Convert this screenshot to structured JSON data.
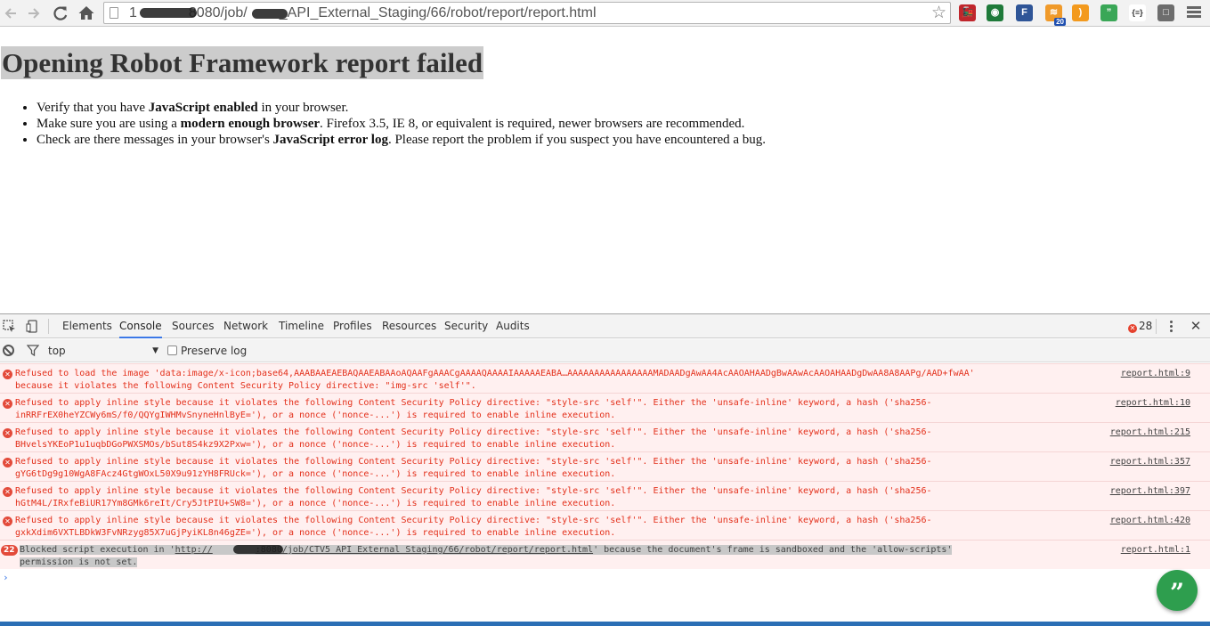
{
  "browser": {
    "url_parts": [
      "1",
      "8080/job/",
      "_API_External_Staging/66/robot/report/report.html"
    ],
    "extensions": [
      {
        "name": "train-ext-icon",
        "color": "#c0262c",
        "glyph": "🚂",
        "badge": ""
      },
      {
        "name": "evernote-ext-icon",
        "color": "#1f7a3a",
        "glyph": "◉",
        "badge": ""
      },
      {
        "name": "feedly-ext-icon",
        "color": "#2f5597",
        "glyph": "F",
        "badge": ""
      },
      {
        "name": "rss-badge-ext-icon",
        "color": "#f09a2a",
        "glyph": "≋",
        "badge": "20"
      },
      {
        "name": "rss-ext-icon",
        "color": "#f39a1e",
        "glyph": ")",
        "badge": ""
      },
      {
        "name": "hangouts-ext-icon",
        "color": "#3aa757",
        "glyph": "”",
        "badge": ""
      },
      {
        "name": "json-ext-icon",
        "color": "#ffffff",
        "glyph": "{≡}",
        "badge": ""
      },
      {
        "name": "window-ext-icon",
        "color": "#6d6d6d",
        "glyph": "□",
        "badge": ""
      }
    ]
  },
  "page": {
    "title": "Opening Robot Framework report failed",
    "items": [
      {
        "pre": "Verify that you have ",
        "bold": "JavaScript enabled",
        "post": " in your browser."
      },
      {
        "pre": "Make sure you are using a ",
        "bold": "modern enough browser",
        "post": ". Firefox 3.5, IE 8, or equivalent is required, newer browsers are recommended."
      },
      {
        "pre": "Check are there messages in your browser's ",
        "bold": "JavaScript error log",
        "post": ". Please report the problem if you suspect you have encountered a bug."
      }
    ]
  },
  "devtools": {
    "tabs": [
      "Elements",
      "Console",
      "Sources",
      "Network",
      "Timeline",
      "Profiles",
      "Resources",
      "Security",
      "Audits"
    ],
    "active_tab": "Console",
    "error_count": "28",
    "context": "top",
    "preserve_log": "Preserve log",
    "messages": [
      {
        "text": "Refused to load the image 'data:image/x-icon;base64,AAABAAEAEBAQAAEABAAoAQAAFgAAACgAAAAQAAAAIAAAAAEABA…AAAAAAAAAAAAAAAAMADAADgAwAA4AcAAOAHAADgBwAAwAcAAOAHAADgDwAA8A8AAPg/AAD+fwAA'\nbecause it violates the following Content Security Policy directive: \"img-src 'self'\".",
        "src": "report.html:9"
      },
      {
        "text": "Refused to apply inline style because it violates the following Content Security Policy directive: \"style-src 'self'\". Either the 'unsafe-inline' keyword, a hash ('sha256-\ninRRFrEX0heYZCWy6mS/f0/QQYgIWHMvSnyneHnlByE='), or a nonce ('nonce-...') is required to enable inline execution.",
        "src": "report.html:10"
      },
      {
        "text": "Refused to apply inline style because it violates the following Content Security Policy directive: \"style-src 'self'\". Either the 'unsafe-inline' keyword, a hash ('sha256-\nBHvelsYKEoP1u1uqbDGoPWXSMOs/bSut8S4kz9X2Pxw='), or a nonce ('nonce-...') is required to enable inline execution.",
        "src": "report.html:215"
      },
      {
        "text": "Refused to apply inline style because it violates the following Content Security Policy directive: \"style-src 'self'\". Either the 'unsafe-inline' keyword, a hash ('sha256-\ngYG6tDg9g10WgA8FAcz4GtgWOxL50X9u91zYH8FRUck='), or a nonce ('nonce-...') is required to enable inline execution.",
        "src": "report.html:357"
      },
      {
        "text": "Refused to apply inline style because it violates the following Content Security Policy directive: \"style-src 'self'\". Either the 'unsafe-inline' keyword, a hash ('sha256-\nhGtM4L/IRxfeBiUR17Ym8GMk6reIt/Cry5JtPIU+SW8='), or a nonce ('nonce-...') is required to enable inline execution.",
        "src": "report.html:397"
      },
      {
        "text": "Refused to apply inline style because it violates the following Content Security Policy directive: \"style-src 'self'\". Either the 'unsafe-inline' keyword, a hash ('sha256-\ngxkXdim6VXTLBDkW3FvNRzyg85X7uGjPyiKL8n46gZE='), or a nonce ('nonce-...') is required to enable inline execution.",
        "src": "report.html:420"
      }
    ],
    "blocked": {
      "count": "22",
      "pre": "Blocked script execution in '",
      "url_a": "http://",
      "url_b": ":8080/job/CTV5 API External Staging/66/robot/report/report.html",
      "post": "' because the document's frame is sandboxed and the 'allow-scripts'",
      "line2": "permission is not set.",
      "src": "report.html:1"
    },
    "prompt": "›"
  }
}
